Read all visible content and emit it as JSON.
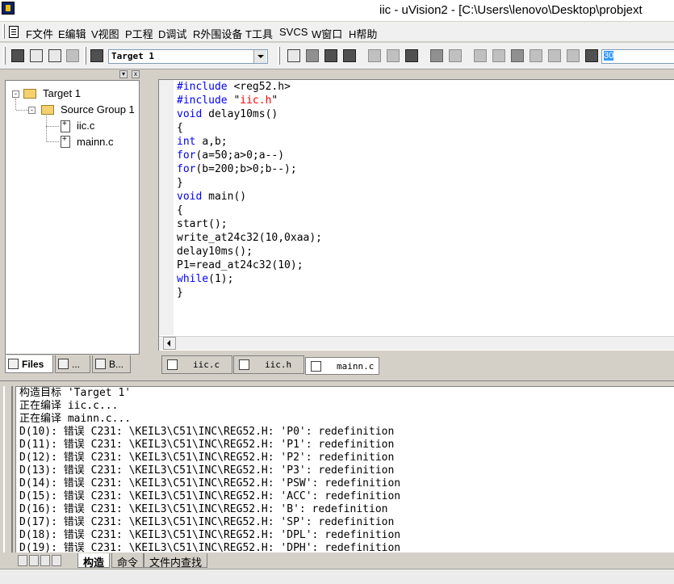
{
  "window": {
    "title": "iic  - uVision2 - [C:\\Users\\lenovo\\Desktop\\probjext"
  },
  "menu": [
    {
      "id": "file",
      "label": "F文件"
    },
    {
      "id": "edit",
      "label": "E编辑"
    },
    {
      "id": "view",
      "label": "V视图"
    },
    {
      "id": "project",
      "label": "P工程"
    },
    {
      "id": "debug",
      "label": "D调试"
    },
    {
      "id": "peripherals",
      "label": "R外围设备"
    },
    {
      "id": "tools",
      "label": "T工具"
    },
    {
      "id": "svcs",
      "label": "SVCS"
    },
    {
      "id": "window",
      "label": "W窗口"
    },
    {
      "id": "help",
      "label": "H帮助"
    }
  ],
  "toolbar": {
    "target_select": "Target 1",
    "find_value": "30",
    "icons": [
      "translate-icon",
      "build-icon",
      "rebuild-icon",
      "stop-build-icon",
      "target-options-icon",
      "new-file-icon",
      "open-file-icon",
      "save-icon",
      "save-all-icon",
      "cut-icon",
      "copy-icon",
      "paste-icon",
      "undo-icon",
      "redo-icon",
      "indent-icon",
      "unindent-icon",
      "bookmark-icon",
      "next-bookmark-icon",
      "prev-bookmark-icon",
      "clear-bookmarks-icon",
      "find-in-files-icon"
    ]
  },
  "project": {
    "target": "Target 1",
    "group": "Source Group 1",
    "files": [
      "iic.c",
      "mainn.c"
    ],
    "tabs": {
      "files": "Files",
      "regs": "...",
      "books": "B..."
    }
  },
  "editor": {
    "tabs": [
      "iic.c",
      "iic.h",
      "mainn.c"
    ],
    "active_tab": "mainn.c",
    "code": [
      [
        {
          "t": "#include ",
          "c": "kw"
        },
        {
          "t": "<reg52.h>",
          "c": "plain"
        }
      ],
      [
        {
          "t": "#include ",
          "c": "kw"
        },
        {
          "t": "\"",
          "c": "plain"
        },
        {
          "t": "iic.h",
          "c": "str"
        },
        {
          "t": "\"",
          "c": "plain"
        }
      ],
      [
        {
          "t": "void ",
          "c": "kw"
        },
        {
          "t": "delay10ms()",
          "c": "plain"
        }
      ],
      [
        {
          "t": "{",
          "c": "plain"
        }
      ],
      [
        {
          "t": "int ",
          "c": "kw"
        },
        {
          "t": "a,b;",
          "c": "plain"
        }
      ],
      [
        {
          "t": "for",
          "c": "kw"
        },
        {
          "t": "(a=50;a>0;a--)",
          "c": "plain"
        }
      ],
      [
        {
          "t": "for",
          "c": "kw"
        },
        {
          "t": "(b=200;b>0;b--);",
          "c": "plain"
        }
      ],
      [
        {
          "t": "}",
          "c": "plain"
        }
      ],
      [
        {
          "t": "void ",
          "c": "kw"
        },
        {
          "t": "main()",
          "c": "plain"
        }
      ],
      [
        {
          "t": "{",
          "c": "plain"
        }
      ],
      [
        {
          "t": "start();",
          "c": "plain"
        }
      ],
      [
        {
          "t": "write_at24c32(10,0xaa);",
          "c": "plain"
        }
      ],
      [
        {
          "t": "delay10ms();",
          "c": "plain"
        }
      ],
      [
        {
          "t": "P1=read_at24c32(10);",
          "c": "plain"
        }
      ],
      [
        {
          "t": "while",
          "c": "kw"
        },
        {
          "t": "(1);",
          "c": "plain"
        }
      ],
      [
        {
          "t": "}",
          "c": "plain"
        }
      ]
    ]
  },
  "output": {
    "lines": [
      "构造目标 'Target 1'",
      "正在编译 iic.c...",
      "正在编译 mainn.c...",
      "D(10): 错误 C231: \\KEIL3\\C51\\INC\\REG52.H: 'P0': redefinition",
      "D(11): 错误 C231: \\KEIL3\\C51\\INC\\REG52.H: 'P1': redefinition",
      "D(12): 错误 C231: \\KEIL3\\C51\\INC\\REG52.H: 'P2': redefinition",
      "D(13): 错误 C231: \\KEIL3\\C51\\INC\\REG52.H: 'P3': redefinition",
      "D(14): 错误 C231: \\KEIL3\\C51\\INC\\REG52.H: 'PSW': redefinition",
      "D(15): 错误 C231: \\KEIL3\\C51\\INC\\REG52.H: 'ACC': redefinition",
      "D(16): 错误 C231: \\KEIL3\\C51\\INC\\REG52.H: 'B': redefinition",
      "D(17): 错误 C231: \\KEIL3\\C51\\INC\\REG52.H: 'SP': redefinition",
      "D(18): 错误 C231: \\KEIL3\\C51\\INC\\REG52.H: 'DPL': redefinition",
      "D(19): 错误 C231: \\KEIL3\\C51\\INC\\REG52.H: 'DPH': redefinition"
    ],
    "tabs": [
      "构造",
      "命令",
      "文件内查找"
    ],
    "active_tab": "构造"
  }
}
